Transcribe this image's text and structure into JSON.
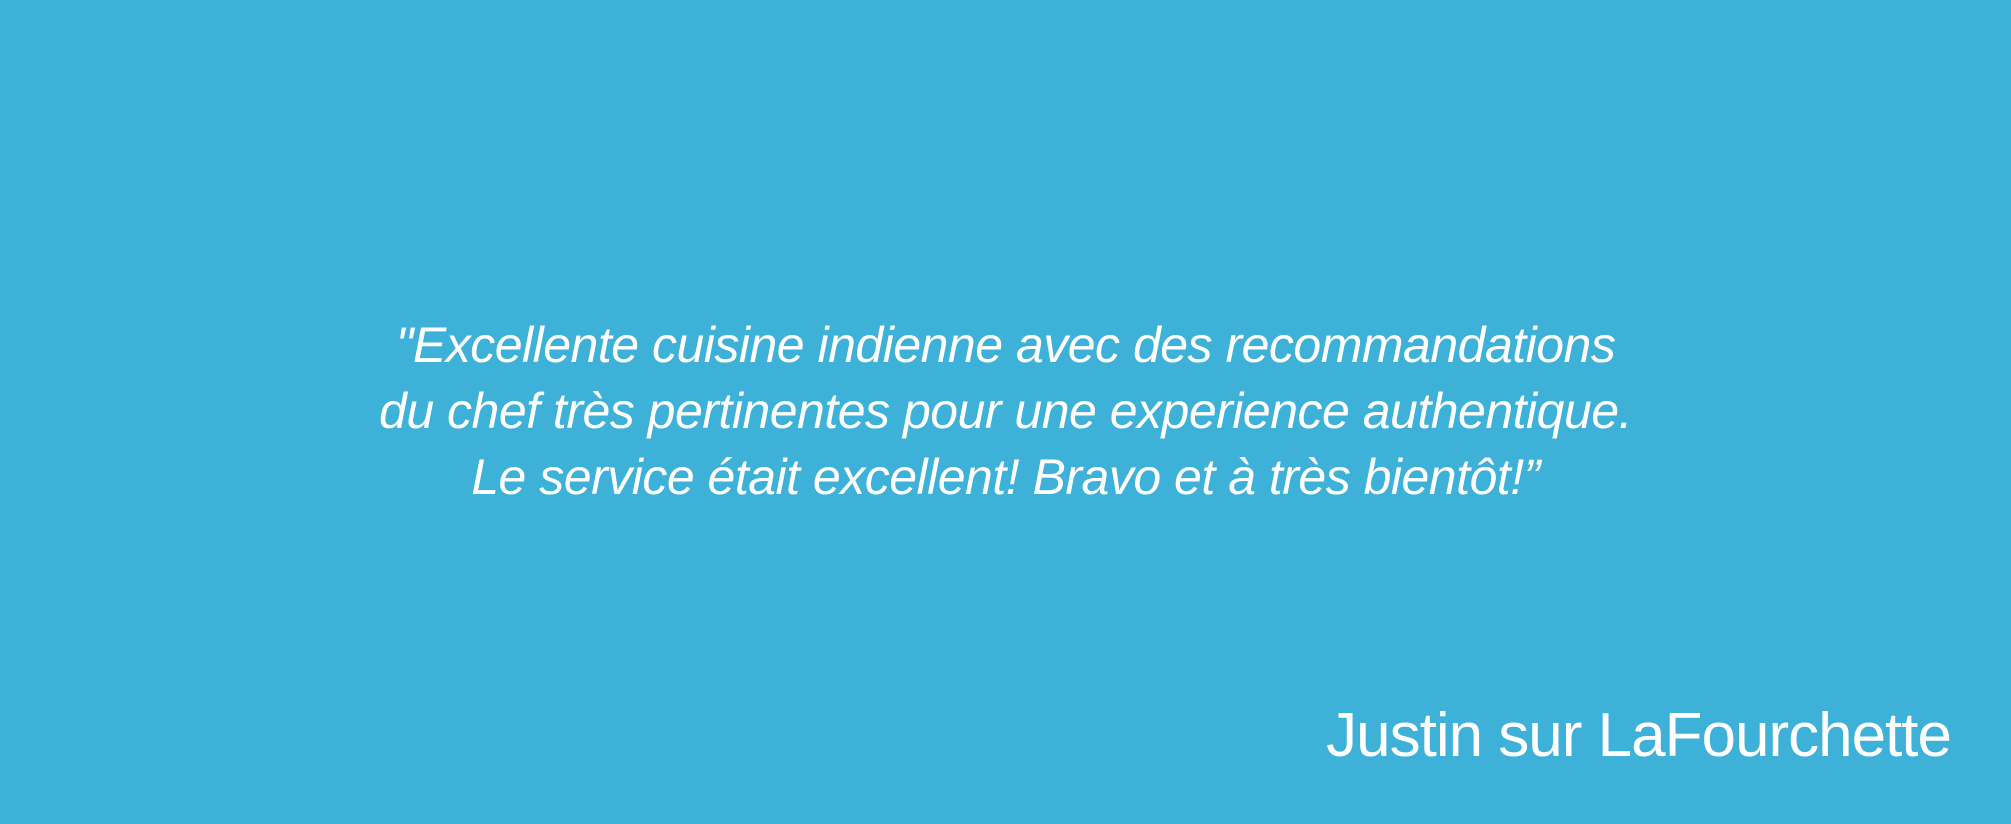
{
  "testimonial": {
    "quote_lines": [
      "\"Excellente cuisine indienne avec des recommandations",
      "du chef très pertinentes pour une experience authentique.",
      "Le service était excellent! Bravo et à très bientôt!”"
    ],
    "attribution": "Justin sur LaFourchette"
  },
  "colors": {
    "background": "#3db1d8",
    "text": "#ffffff"
  }
}
